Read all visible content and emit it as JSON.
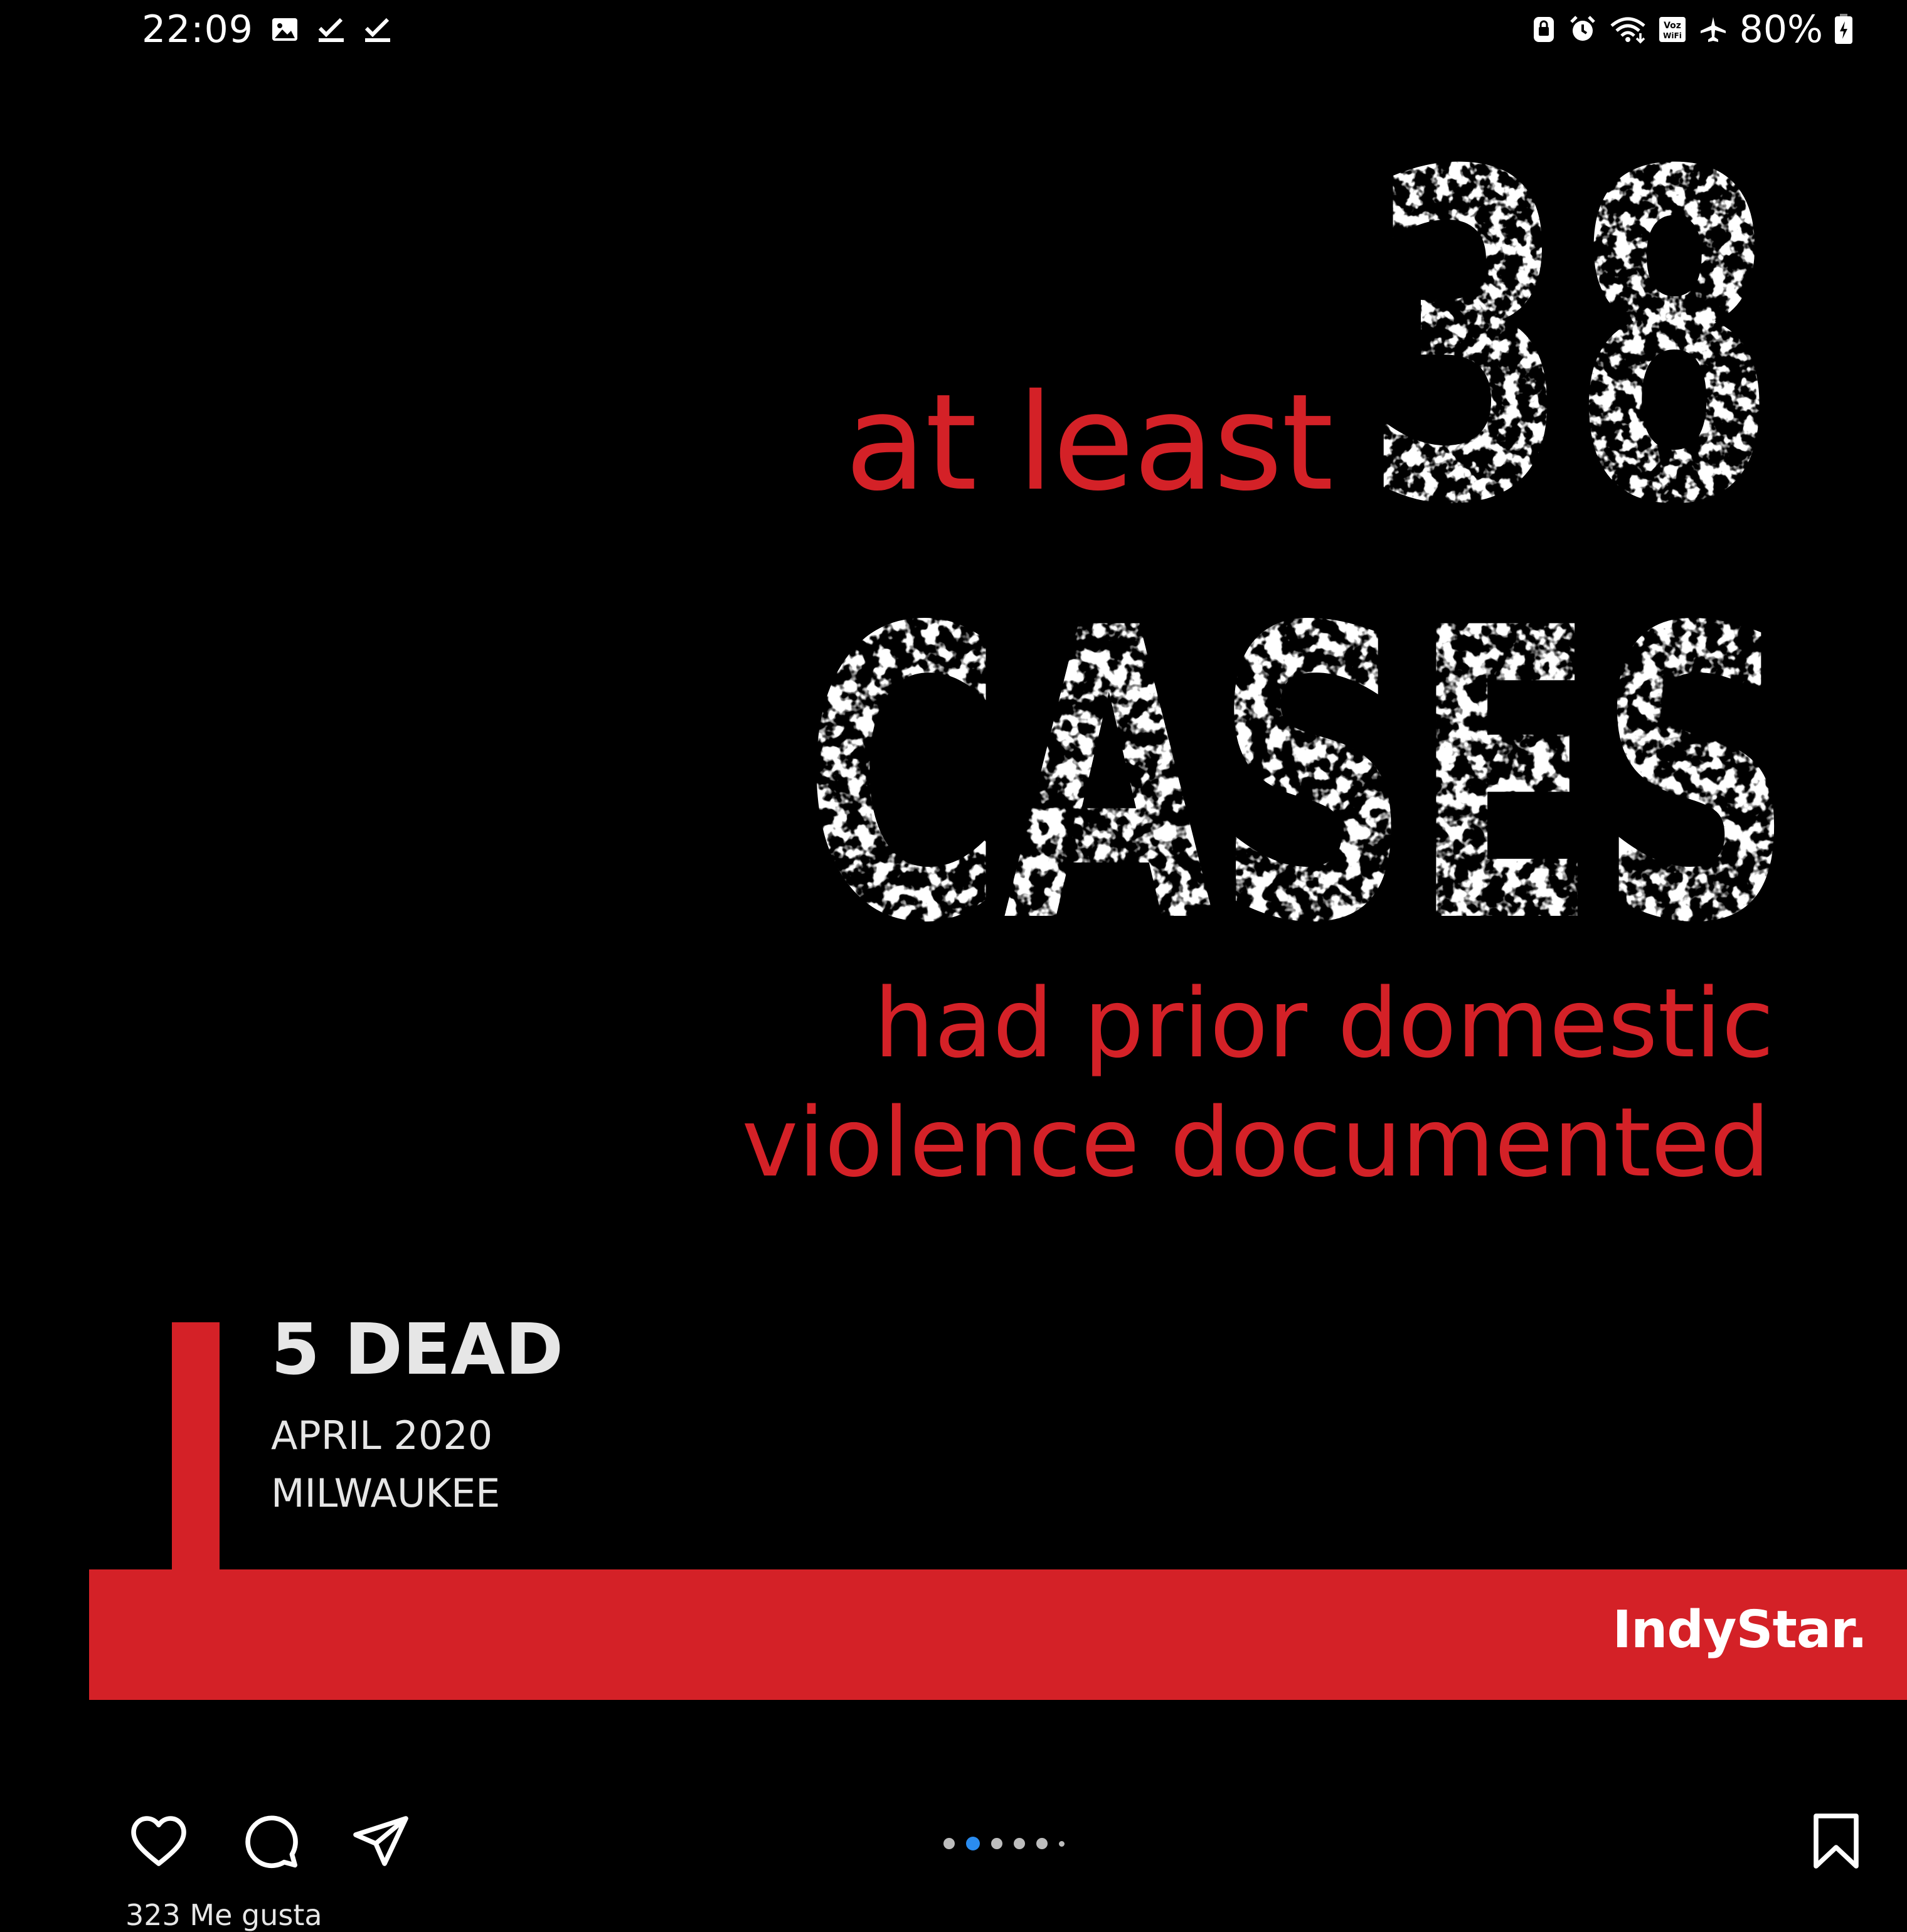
{
  "status_bar": {
    "time": "22:09",
    "battery_text": "80%",
    "left_icons": [
      "image-icon",
      "check-icon",
      "check-icon"
    ],
    "right_icons": [
      "lock-icon",
      "alarm-icon",
      "wifi-icon",
      "voz-wifi-icon",
      "airplane-icon",
      "battery-icon"
    ],
    "voz_wifi_label_top": "Voz",
    "voz_wifi_label_bottom": "WiFi"
  },
  "post": {
    "big_number": "38",
    "at_least": "at least",
    "cases": "CASES",
    "line1": "had prior domestic",
    "line2": "violence documented",
    "dead": "5 DEAD",
    "date": "APRIL 2020",
    "city": "MILWAUKEE",
    "brand": "IndyStar.",
    "accent_color": "#d42127"
  },
  "actions": {
    "like_icon": "heart-icon",
    "comment_icon": "comment-icon",
    "share_icon": "send-icon",
    "save_icon": "bookmark-icon",
    "carousel_total": 6,
    "carousel_active": 2,
    "active_dot_color": "#2a8cf0"
  },
  "likes": {
    "text": "323 Me gusta"
  }
}
